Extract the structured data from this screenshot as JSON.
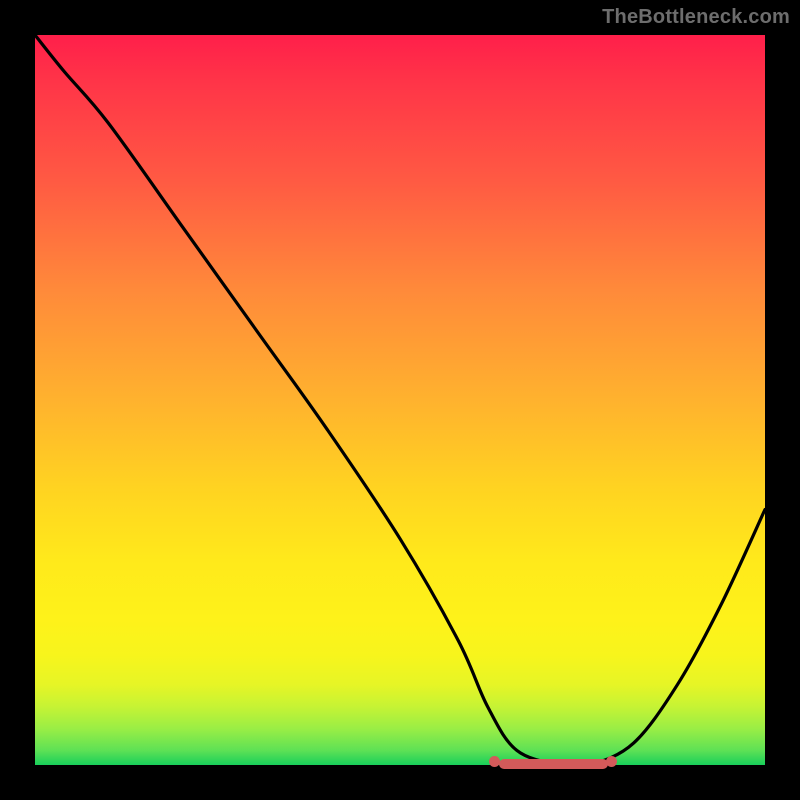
{
  "watermark": "TheBottleneck.com",
  "colors": {
    "background": "#000000",
    "curve": "#000000",
    "highlight_segment": "#d35a5a",
    "watermark_text": "#6d6d6d"
  },
  "chart_data": {
    "type": "line",
    "title": "",
    "xlabel": "",
    "ylabel": "",
    "xlim": [
      0,
      100
    ],
    "ylim": [
      0,
      100
    ],
    "grid": false,
    "legend": false,
    "series": [
      {
        "name": "bottleneck-curve",
        "x": [
          0,
          4,
          10,
          20,
          30,
          40,
          50,
          58,
          62,
          66,
          72,
          76,
          82,
          88,
          94,
          100
        ],
        "y": [
          100,
          95,
          88,
          74,
          60,
          46,
          31,
          17,
          8,
          2,
          0,
          0,
          3,
          11,
          22,
          35
        ]
      }
    ],
    "annotations": [
      {
        "type": "flat-minimum-highlight",
        "x_start": 63,
        "x_end": 79,
        "color": "#d35a5a"
      }
    ]
  }
}
